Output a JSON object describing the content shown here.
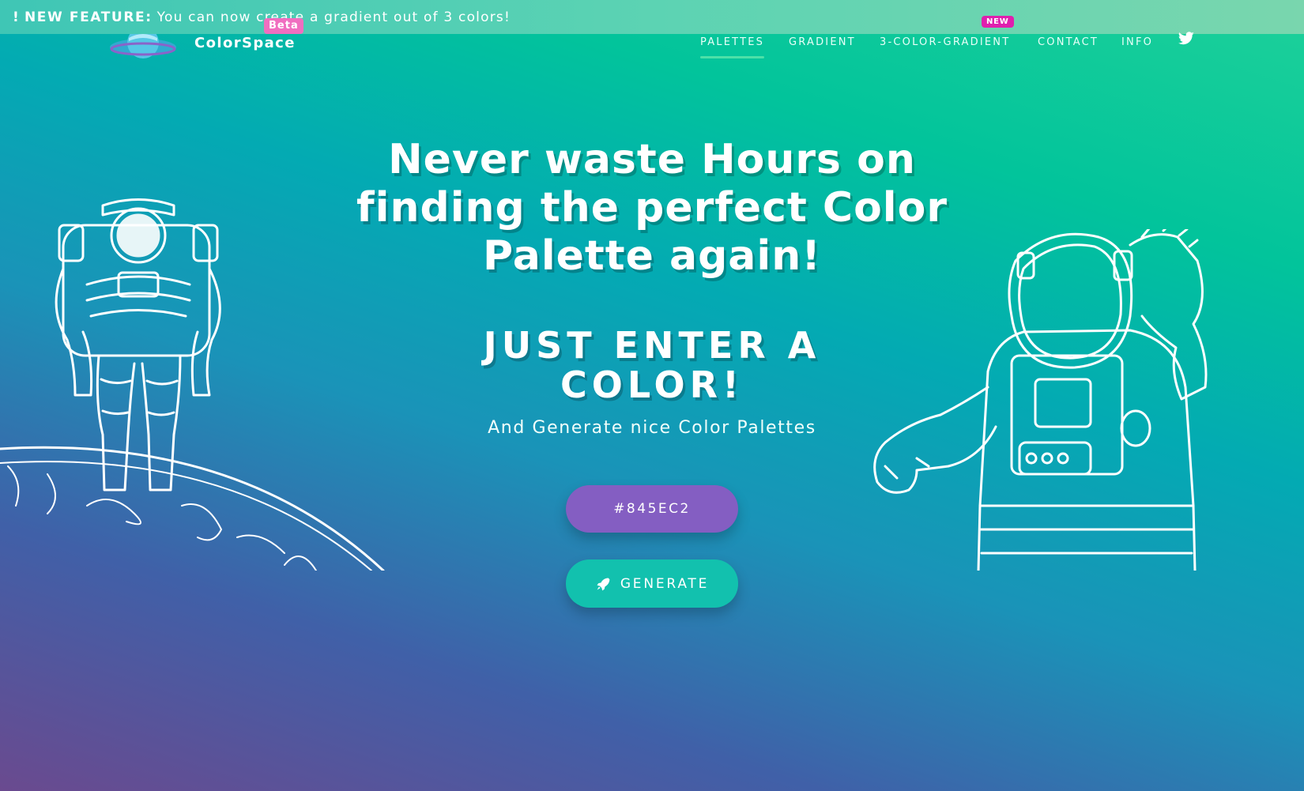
{
  "banner": {
    "bang": "!",
    "tag": "NEW FEATURE:",
    "message": "You can now create a gradient out of 3 colors!"
  },
  "header": {
    "brand": "ColorSpace",
    "beta_badge": "Beta",
    "new_badge": "NEW",
    "nav": [
      {
        "label": "PALETTES",
        "active": true
      },
      {
        "label": "GRADIENT",
        "active": false
      },
      {
        "label": "3-COLOR-GRADIENT",
        "active": false
      },
      {
        "label": "CONTACT",
        "active": false
      },
      {
        "label": "INFO",
        "active": false
      }
    ],
    "twitter_icon": "twitter-icon"
  },
  "hero": {
    "title": "Never waste Hours on finding the perfect Color Palette again!",
    "subtitle": "JUST ENTER A COLOR!",
    "description": "And Generate nice Color Palettes",
    "color_input_value": "#845EC2",
    "generate_label": "GENERATE",
    "generate_icon": "rocket-icon"
  },
  "colors": {
    "input_bg": "#845ec2",
    "generate_bg": "#12c1ae",
    "beta_bg": "#f06ec0",
    "new_bg": "#e01fae",
    "active_underline": "#4de0a8"
  }
}
